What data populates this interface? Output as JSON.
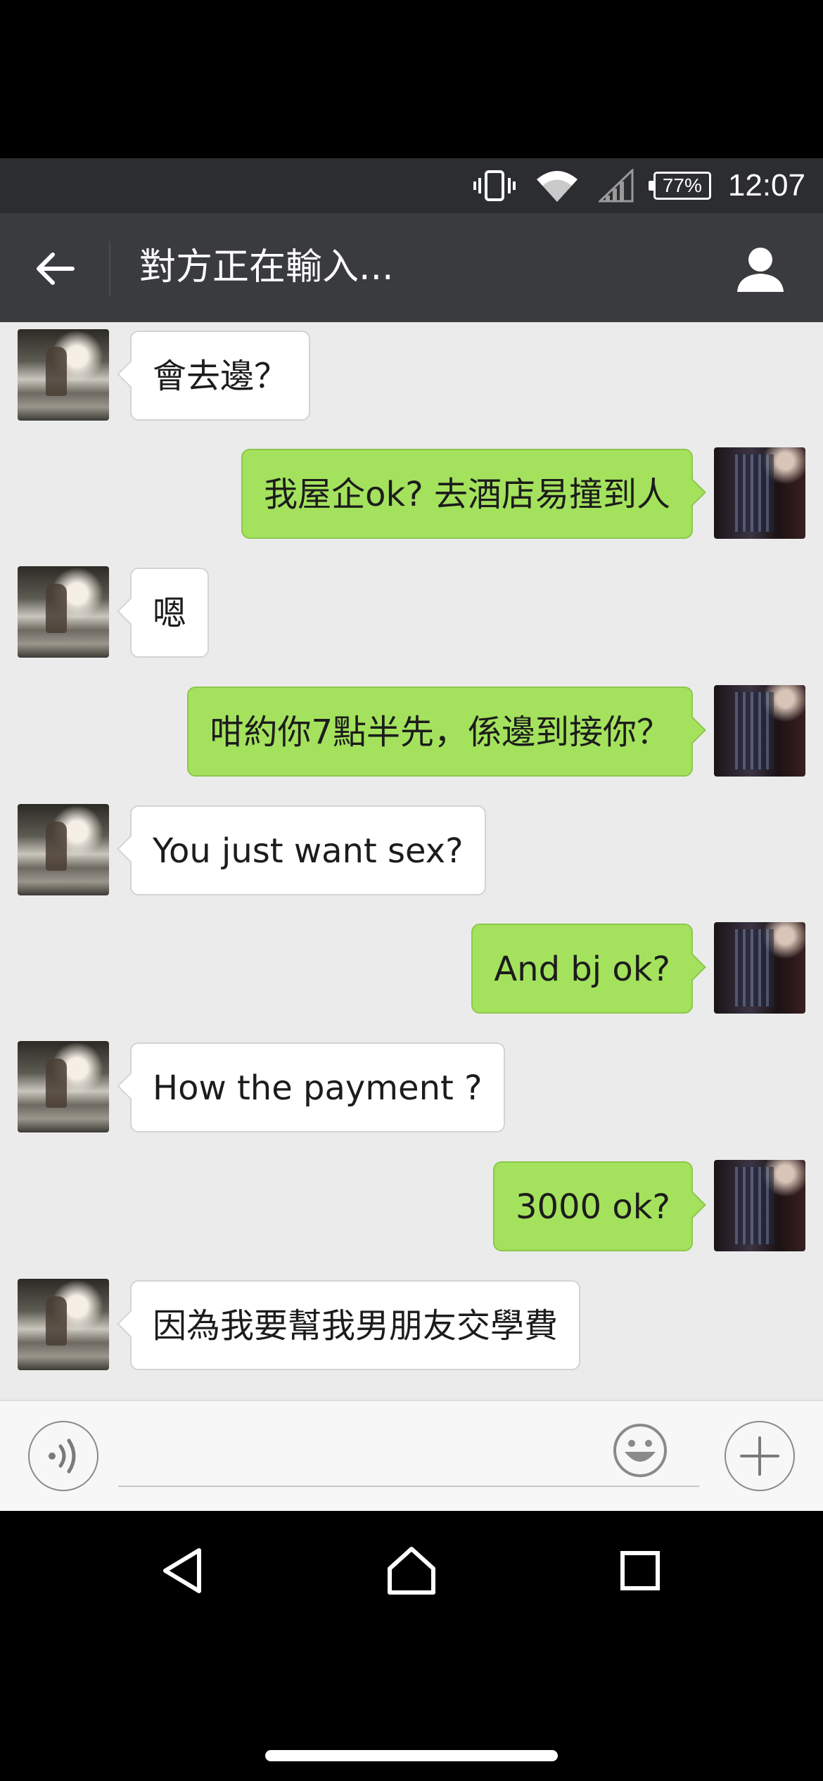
{
  "status_bar": {
    "battery_level": "77%",
    "time": "12:07",
    "icons": [
      "vibrate-icon",
      "wifi-icon",
      "cell-signal-icon",
      "battery-icon"
    ]
  },
  "header": {
    "title": "對方正在輸入...",
    "back_icon": "back-arrow-icon",
    "profile_icon": "person-icon"
  },
  "messages": [
    {
      "side": "in",
      "text": "會去邊？"
    },
    {
      "side": "out",
      "text": "我屋企ok?  去酒店易撞到人"
    },
    {
      "side": "in",
      "text": "嗯"
    },
    {
      "side": "out",
      "text": "咁約你7點半先，係邊到接你？"
    },
    {
      "side": "in",
      "text": "You just want sex?"
    },
    {
      "side": "out",
      "text": "And bj ok?"
    },
    {
      "side": "in",
      "text": "How the payment ?"
    },
    {
      "side": "out",
      "text": "3000 ok?"
    },
    {
      "side": "in",
      "text": "因為我要幫我男朋友交學費"
    }
  ],
  "input_bar": {
    "placeholder": "",
    "value": "",
    "icons": [
      "voice-icon",
      "emoji-icon",
      "plus-icon"
    ]
  },
  "nav_bar": {
    "icons": [
      "nav-back-icon",
      "nav-home-icon",
      "nav-recents-icon"
    ]
  },
  "colors": {
    "incoming_bubble": "#ffffff",
    "outgoing_bubble": "#a4e25d",
    "chat_background": "#ebebeb",
    "app_bar": "#3a3b3f",
    "status_bar": "#2c2d30"
  }
}
